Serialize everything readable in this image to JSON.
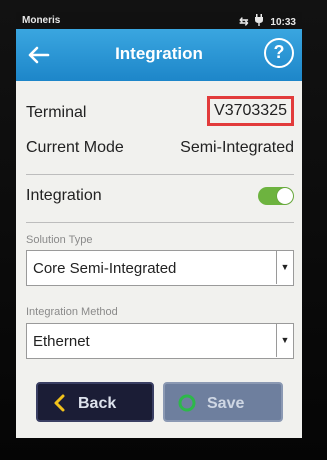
{
  "status_bar": {
    "carrier": "Moneris",
    "time": "10:33",
    "icons": [
      "sync-icon",
      "power-plug-icon"
    ]
  },
  "header": {
    "title": "Integration",
    "back_icon": "arrow-left-icon",
    "help_label": "?"
  },
  "terminal": {
    "label": "Terminal",
    "value": "V3703325",
    "highlight_color": "#e23b3b"
  },
  "current_mode": {
    "label": "Current Mode",
    "value": "Semi-Integrated"
  },
  "integration": {
    "label": "Integration",
    "enabled": true,
    "toggle_color": "#6db33f"
  },
  "solution_type": {
    "label": "Solution Type",
    "value": "Core Semi-Integrated"
  },
  "integration_method": {
    "label": "Integration Method",
    "value": "Ethernet"
  },
  "buttons": {
    "back_label": "Back",
    "back_icon": "chevron-left-icon",
    "save_label": "Save",
    "save_icon": "circle-icon",
    "icon_color": "#f2c21b",
    "save_icon_color": "#2db84a"
  },
  "colors": {
    "header": "#2a96d5",
    "back_button": "#1b1d36",
    "save_button": "#6e7f9e"
  }
}
